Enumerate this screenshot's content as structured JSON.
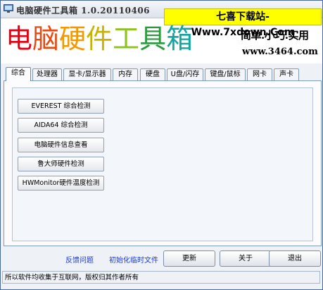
{
  "window": {
    "title": "电脑硬件工具箱 1.0.20110406"
  },
  "watermark": "七喜下载站-Www.7xdown.Com",
  "banner": {
    "logo_chars": [
      {
        "ch": "电",
        "color": "#e60012"
      },
      {
        "ch": "脑",
        "color": "#e64a10"
      },
      {
        "ch": "硬",
        "color": "#f39800"
      },
      {
        "ch": "件",
        "color": "#c8b400"
      },
      {
        "ch": "工",
        "color": "#8fc31f"
      },
      {
        "ch": "具",
        "color": "#2a9a3c"
      },
      {
        "ch": "箱",
        "color": "#13a6a0"
      }
    ],
    "slogan": "简单.小巧.实用",
    "site": "www.3464.com"
  },
  "tabs": [
    {
      "label": "综合",
      "active": true
    },
    {
      "label": "处理器",
      "active": false
    },
    {
      "label": "显卡/显示器",
      "active": false
    },
    {
      "label": "内存",
      "active": false
    },
    {
      "label": "硬盘",
      "active": false
    },
    {
      "label": "U盘/闪存",
      "active": false
    },
    {
      "label": "键盘/鼠标",
      "active": false
    },
    {
      "label": "网卡",
      "active": false
    },
    {
      "label": "声卡",
      "active": false
    }
  ],
  "tools": [
    "EVEREST 综合检测",
    "AIDA64  综合检测",
    "电脑硬件信息查看",
    "鲁大师硬件检测",
    "HWMonitor硬件温度检测"
  ],
  "footer": {
    "feedback": "反馈问题",
    "init_temp": "初始化临时文件",
    "update": "更新",
    "about": "关于",
    "exit": "退出"
  },
  "status": "所以软件均收集于互联网，版权归其作者所有"
}
